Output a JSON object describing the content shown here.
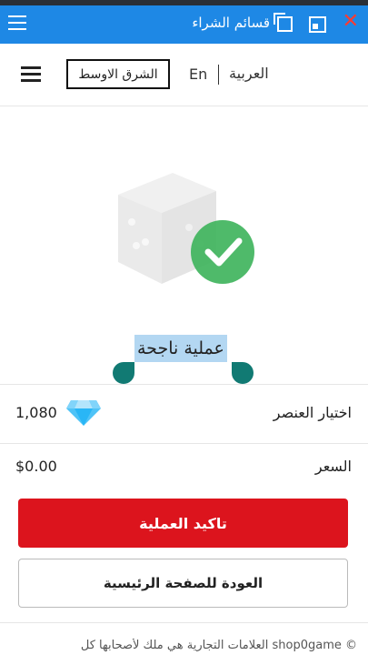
{
  "overlay_bar": {
    "title": "قسائم الشراء",
    "close_glyph": "✕",
    "accent": "#1e88e5"
  },
  "header": {
    "region_label": "الشرق الاوسط",
    "lang_en": "En",
    "lang_ar": "العربية"
  },
  "result": {
    "status_text": "عملية ناجحة",
    "icon": "dice-with-check-icon"
  },
  "order": {
    "item_label": "اختيار العنصر",
    "item_value": "1,080",
    "item_icon": "diamond-icon",
    "price_label": "السعر",
    "price_value": "$0.00"
  },
  "actions": {
    "confirm_label": "تاكيد العملية",
    "home_label": "العودة للصفحة الرئيسية"
  },
  "footer": {
    "text": "© shop0game العلامات التجارية هي ملك لأصحابها كل"
  },
  "colors": {
    "primary_red": "#dc141d",
    "success_green": "#3cb35a",
    "selection_handle": "#117a73"
  }
}
